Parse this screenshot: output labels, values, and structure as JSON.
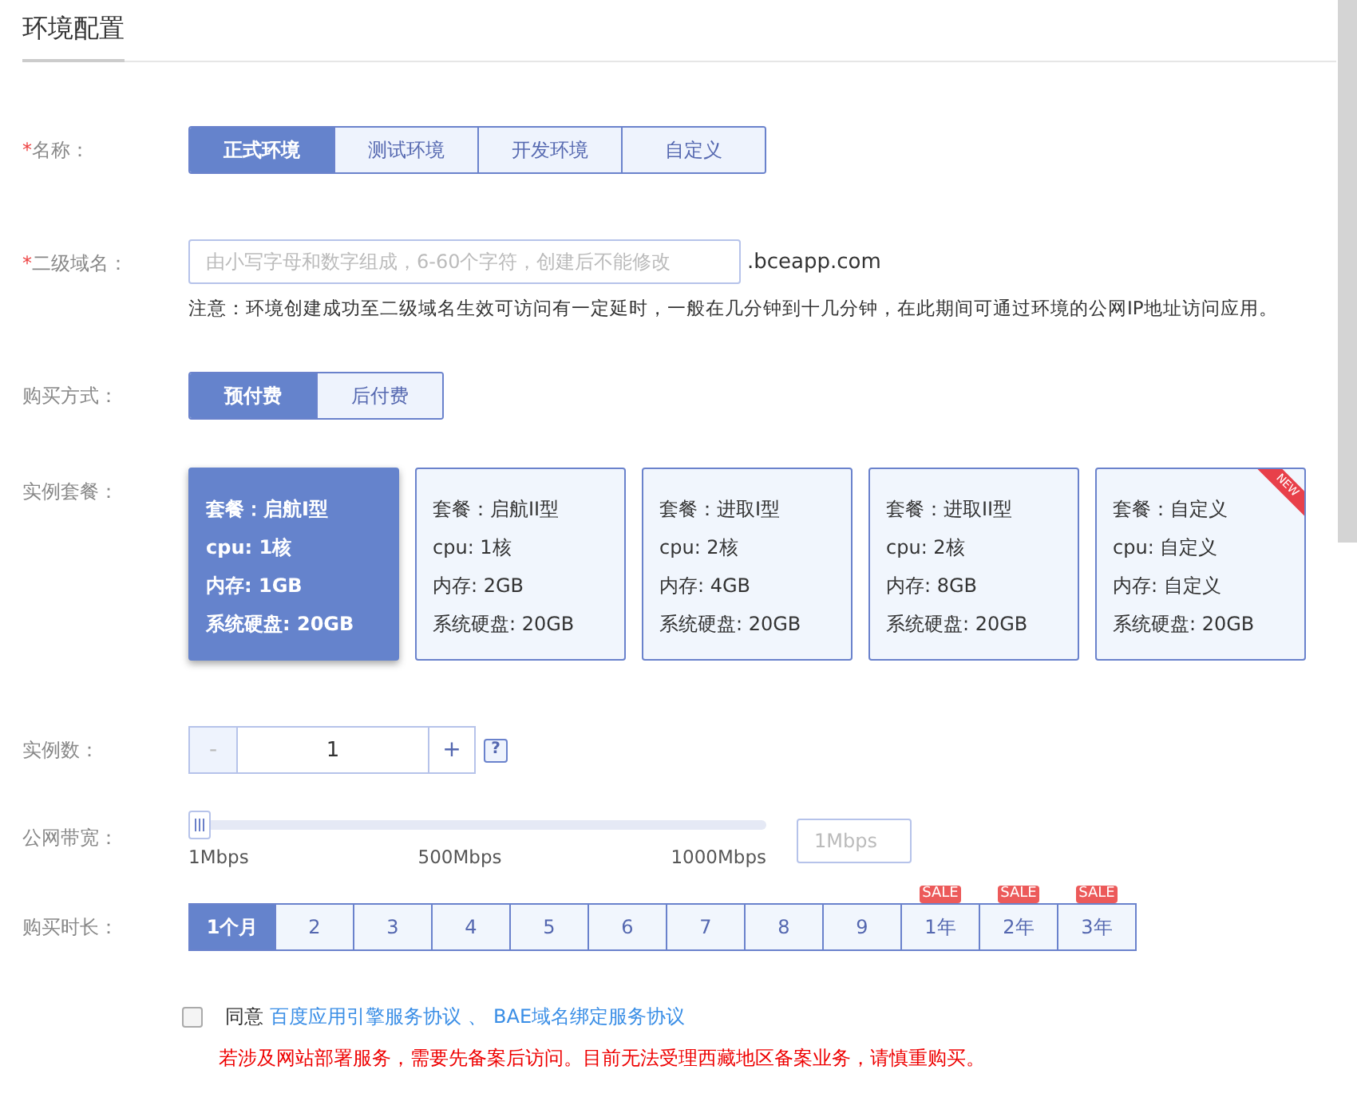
{
  "title": "环境配置",
  "name_field": {
    "label": "名称：",
    "required_mark": "*",
    "options": [
      {
        "label": "正式环境",
        "selected": true
      },
      {
        "label": "测试环境",
        "selected": false
      },
      {
        "label": "开发环境",
        "selected": false
      },
      {
        "label": "自定义",
        "selected": false
      }
    ]
  },
  "domain_field": {
    "label": "二级域名：",
    "required_mark": "*",
    "placeholder": "由小写字母和数字组成，6-60个字符，创建后不能修改",
    "suffix": ".bceapp.com",
    "note": "注意：环境创建成功至二级域名生效可访问有一定延时，一般在几分钟到十几分钟，在此期间可通过环境的公网IP地址访问应用。"
  },
  "payment_field": {
    "label": "购买方式：",
    "options": [
      {
        "label": "预付费",
        "selected": true
      },
      {
        "label": "后付费",
        "selected": false
      }
    ]
  },
  "package_field": {
    "label": "实例套餐：",
    "packages": [
      {
        "selected": true,
        "lines": [
          "套餐：启航I型",
          "cpu: 1核",
          "内存: 1GB",
          "系统硬盘: 20GB"
        ]
      },
      {
        "selected": false,
        "lines": [
          "套餐：启航II型",
          "cpu: 1核",
          "内存: 2GB",
          "系统硬盘: 20GB"
        ]
      },
      {
        "selected": false,
        "lines": [
          "套餐：进取I型",
          "cpu: 2核",
          "内存: 4GB",
          "系统硬盘: 20GB"
        ]
      },
      {
        "selected": false,
        "lines": [
          "套餐：进取II型",
          "cpu: 2核",
          "内存: 8GB",
          "系统硬盘: 20GB"
        ]
      },
      {
        "selected": false,
        "badge": "NEW",
        "lines": [
          "套餐：自定义",
          "cpu: 自定义",
          "内存: 自定义",
          "系统硬盘: 20GB"
        ]
      }
    ]
  },
  "count_field": {
    "label": "实例数：",
    "minus": "-",
    "value": "1",
    "plus": "+",
    "help": "?"
  },
  "bandwidth_field": {
    "label": "公网带宽：",
    "level": 0,
    "ticks": [
      "1Mbps",
      "500Mbps",
      "1000Mbps"
    ],
    "placeholder": "1Mbps"
  },
  "duration_field": {
    "label": "购买时长：",
    "options": [
      {
        "label": "1个月",
        "selected": true
      },
      {
        "label": "2",
        "selected": false
      },
      {
        "label": "3",
        "selected": false
      },
      {
        "label": "4",
        "selected": false
      },
      {
        "label": "5",
        "selected": false
      },
      {
        "label": "6",
        "selected": false
      },
      {
        "label": "7",
        "selected": false
      },
      {
        "label": "8",
        "selected": false
      },
      {
        "label": "9",
        "selected": false
      },
      {
        "label": "1年",
        "selected": false,
        "badge": "SALE"
      },
      {
        "label": "2年",
        "selected": false,
        "badge": "SALE"
      },
      {
        "label": "3年",
        "selected": false,
        "badge": "SALE"
      }
    ]
  },
  "agreement": {
    "checked": false,
    "prefix": "同意",
    "links": [
      "百度应用引擎服务协议",
      "BAE域名绑定服务协议"
    ],
    "separator": "、"
  },
  "warning": "若涉及网站部署服务，需要先备案后访问。目前无法受理西藏地区备案业务，请慎重购买。"
}
